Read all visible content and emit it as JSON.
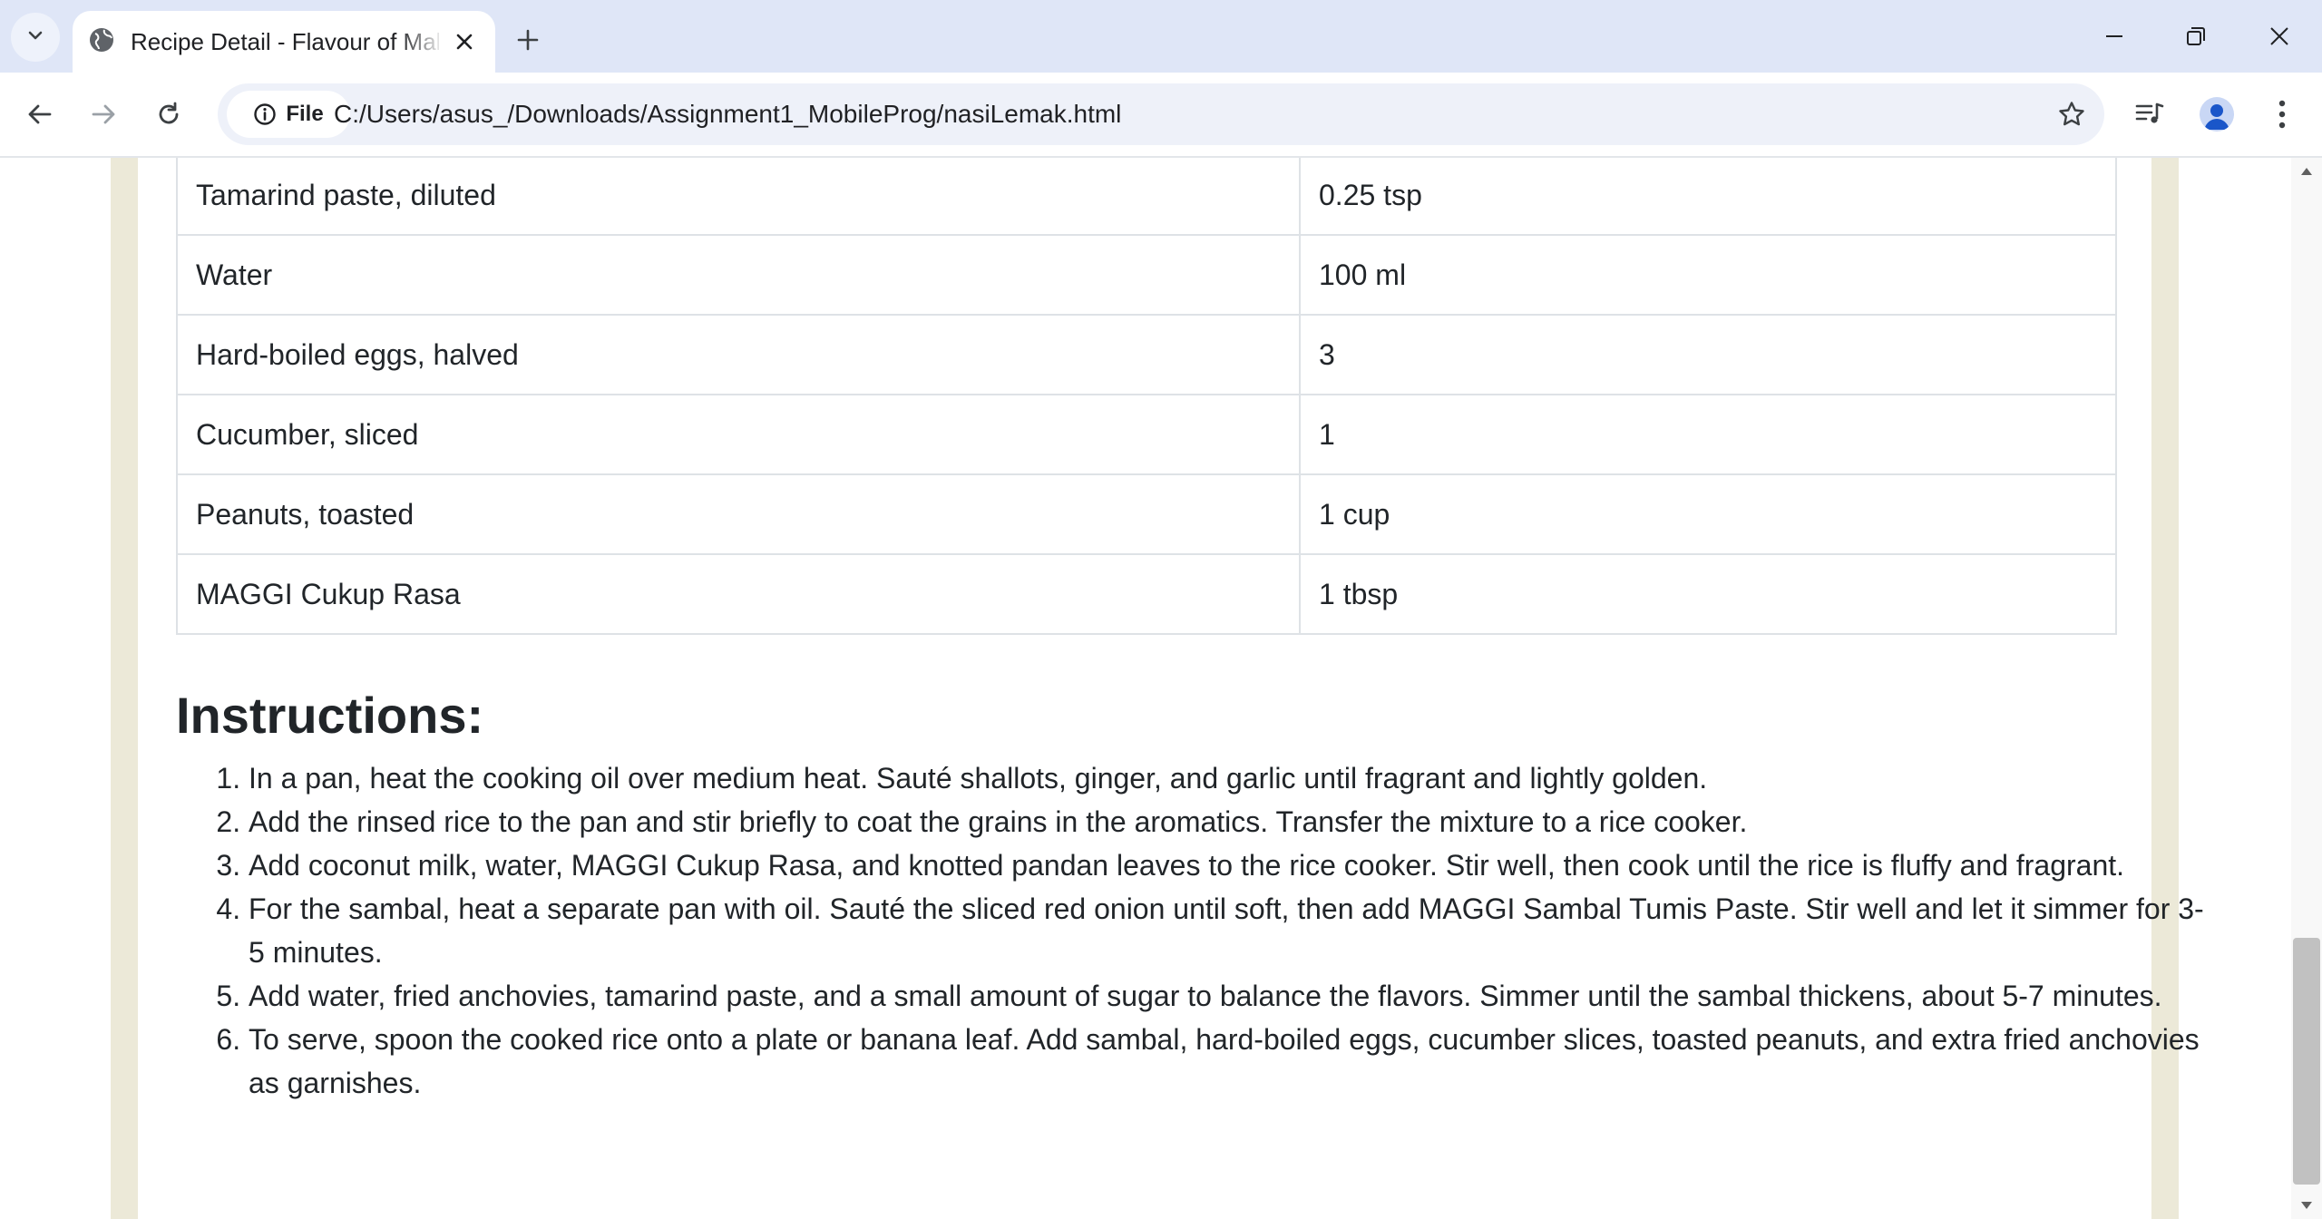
{
  "browser": {
    "tab_title": "Recipe Detail - Flavour of Malaysia",
    "omnibox_chip_label": "File",
    "url": "C:/Users/asus_/Downloads/Assignment1_MobileProg/nasiLemak.html"
  },
  "ingredients_rows": [
    {
      "name": "Tamarind paste, diluted",
      "amount": "0.25 tsp"
    },
    {
      "name": "Water",
      "amount": "100 ml"
    },
    {
      "name": "Hard-boiled eggs, halved",
      "amount": "3"
    },
    {
      "name": "Cucumber, sliced",
      "amount": "1"
    },
    {
      "name": "Peanuts, toasted",
      "amount": "1 cup"
    },
    {
      "name": "MAGGI Cukup Rasa",
      "amount": "1 tbsp"
    }
  ],
  "instructions": {
    "title": "Instructions:",
    "steps": [
      "In a pan, heat the cooking oil over medium heat. Sauté shallots, ginger, and garlic until fragrant and lightly golden.",
      "Add the rinsed rice to the pan and stir briefly to coat the grains in the aromatics. Transfer the mixture to a rice cooker.",
      "Add coconut milk, water, MAGGI Cukup Rasa, and knotted pandan leaves to the rice cooker. Stir well, then cook until the rice is fluffy and fragrant.",
      "For the sambal, heat a separate pan with oil. Sauté the sliced red onion until soft, then add MAGGI Sambal Tumis Paste. Stir well and let it simmer for 3-5 minutes.",
      "Add water, fried anchovies, tamarind paste, and a small amount of sugar to balance the flavors. Simmer until the sambal thickens, about 5-7 minutes.",
      "To serve, spoon the cooked rice onto a plate or banana leaf. Add sambal, hard-boiled eggs, cucumber slices, toasted peanuts, and extra fried anchovies as garnishes."
    ]
  },
  "colors": {
    "tabstrip_bg": "#dfe6f7",
    "page_side_bg": "#ece9d8",
    "table_border": "#dee2e6",
    "text": "#212529"
  },
  "icons": {
    "tab_search": "chevron-down-icon",
    "tab_favicon": "globe-icon",
    "tab_close": "close-icon",
    "new_tab": "plus-icon",
    "minimize": "minimize-icon",
    "restore": "restore-icon",
    "close_window": "close-icon",
    "back": "arrow-left-icon",
    "forward": "arrow-right-icon",
    "reload": "reload-icon",
    "site_info": "info-icon",
    "bookmark": "star-icon",
    "media": "media-control-icon",
    "profile": "profile-icon",
    "menu": "kebab-menu-icon"
  }
}
